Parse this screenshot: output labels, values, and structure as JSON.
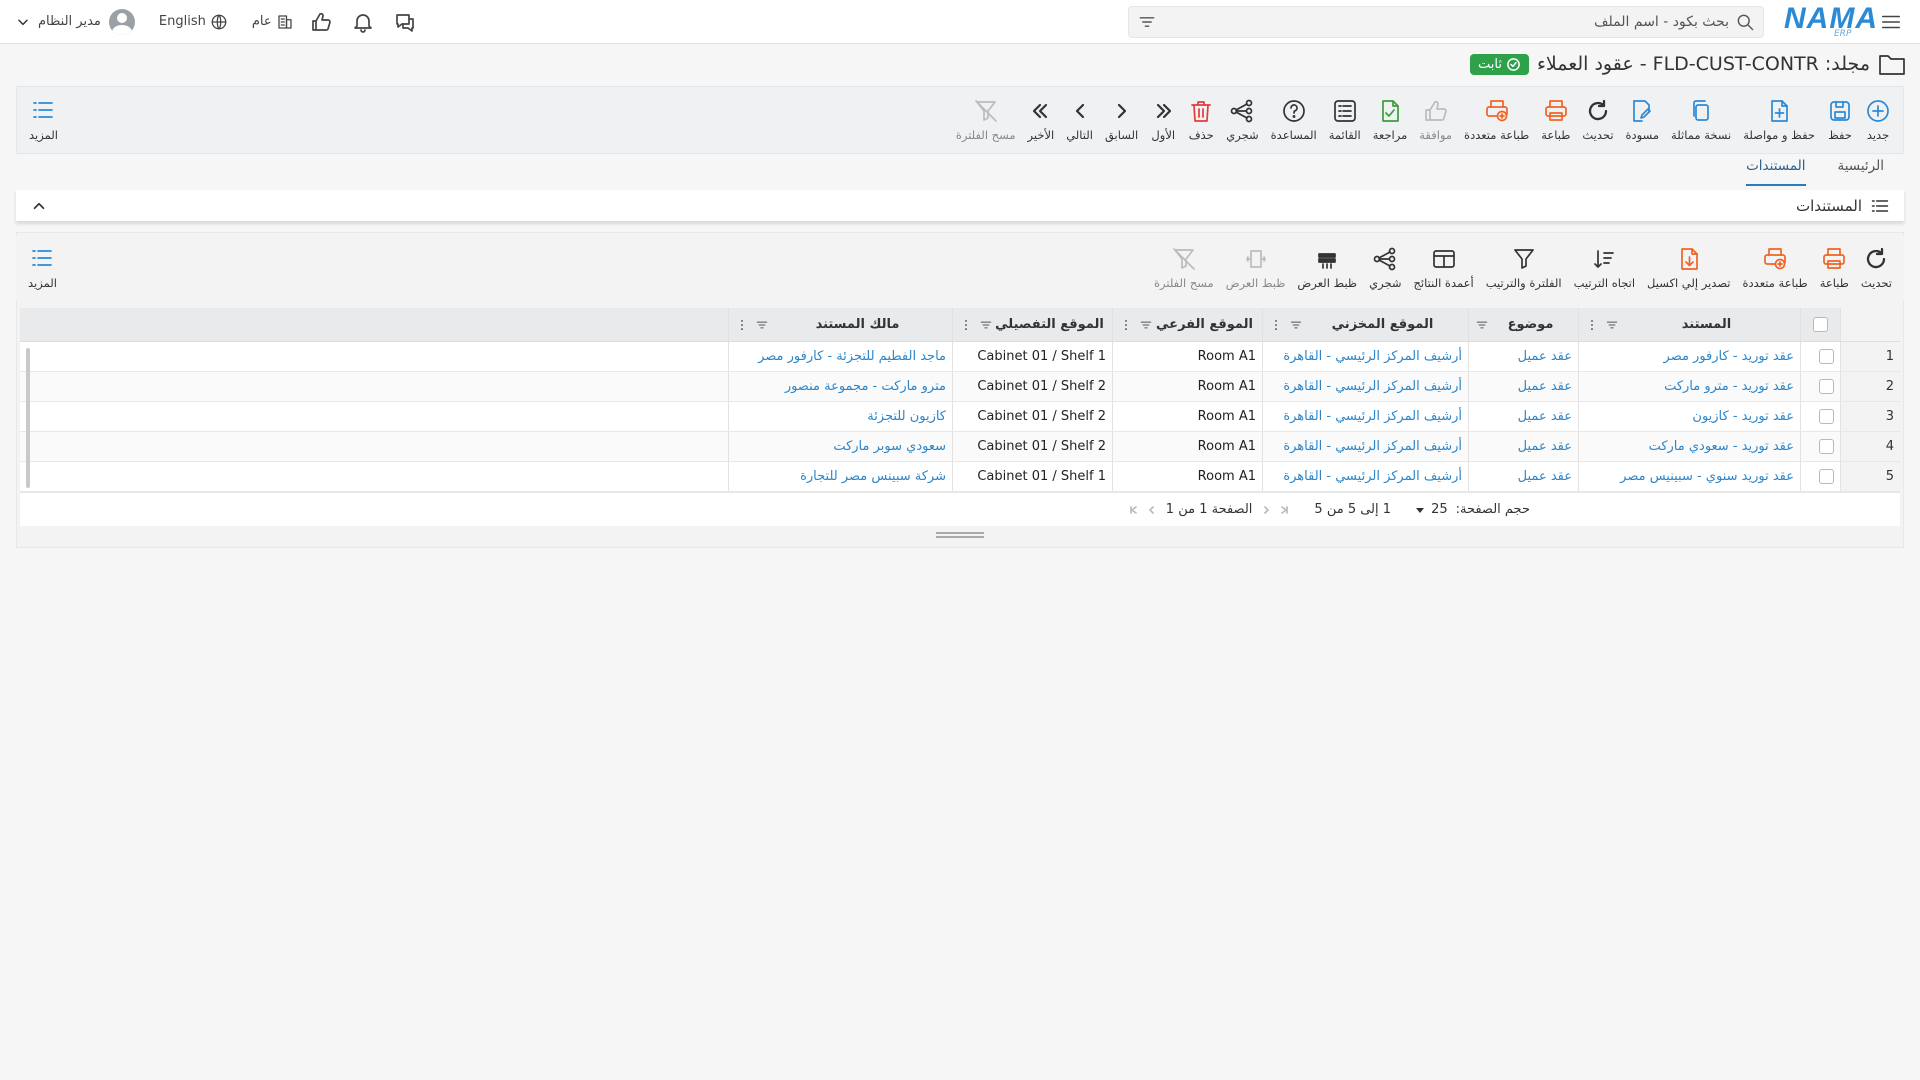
{
  "app": {
    "logo_text": "NAMA",
    "logo_sub": "ERP",
    "search_placeholder": "بحث بكود - اسم الملف",
    "language": "English",
    "scope": "عام",
    "user_name": "مدير النظام"
  },
  "title": {
    "text": "مجلد: FLD-CUST-CONTR - عقود العملاء",
    "status": "ثابت"
  },
  "main_toolbar": {
    "buttons": [
      {
        "label": "جديد",
        "icon": "plus-circle-icon"
      },
      {
        "label": "حفظ",
        "icon": "save-icon"
      },
      {
        "label": "حفظ و مواصلة",
        "icon": "save-continue-icon"
      },
      {
        "label": "نسخة مماثلة",
        "icon": "copy-icon"
      },
      {
        "label": "مسودة",
        "icon": "draft-icon"
      },
      {
        "label": "تحديث",
        "icon": "refresh-icon"
      },
      {
        "label": "طباعة",
        "icon": "print-icon"
      },
      {
        "label": "طباعة متعددة",
        "icon": "multi-print-icon"
      },
      {
        "label": "موافقة",
        "icon": "thumbs-up-icon"
      },
      {
        "label": "مراجعة",
        "icon": "review-icon"
      },
      {
        "label": "القائمة",
        "icon": "list-icon"
      },
      {
        "label": "المساعدة",
        "icon": "help-icon"
      },
      {
        "label": "شجري",
        "icon": "tree-icon"
      },
      {
        "label": "حذف",
        "icon": "trash-icon"
      },
      {
        "label": "الأول",
        "icon": "first-icon"
      },
      {
        "label": "السابق",
        "icon": "prev-icon"
      },
      {
        "label": "التالي",
        "icon": "next-icon"
      },
      {
        "label": "الأخير",
        "icon": "last-icon"
      },
      {
        "label": "مسح الفلترة",
        "icon": "clear-filter-icon"
      }
    ],
    "more": "المزيد"
  },
  "tabs": [
    {
      "label": "الرئيسية",
      "active": false
    },
    {
      "label": "المستندات",
      "active": true
    }
  ],
  "section": {
    "title": "المستندات"
  },
  "grid_toolbar": {
    "buttons": [
      {
        "label": "تحديث",
        "icon": "refresh-icon"
      },
      {
        "label": "طباعة",
        "icon": "print-icon"
      },
      {
        "label": "طباعة متعددة",
        "icon": "multi-print-icon"
      },
      {
        "label": "تصدير إلي اكسيل",
        "icon": "excel-export-icon"
      },
      {
        "label": "اتجاه الترتيب",
        "icon": "sort-direction-icon"
      },
      {
        "label": "الفلترة والترتيب",
        "icon": "filter-icon"
      },
      {
        "label": "أعمدة النتائج",
        "icon": "columns-icon"
      },
      {
        "label": "شجري",
        "icon": "tree-icon"
      },
      {
        "label": "ظبط العرض",
        "icon": "fit-width-icon"
      },
      {
        "label": "ظبط العرض",
        "icon": "fit-columns-icon"
      },
      {
        "label": "مسح الفلترة",
        "icon": "clear-filter-icon"
      }
    ],
    "more": "المزيد"
  },
  "grid": {
    "columns": [
      "المستند",
      "موضوع",
      "الموقع المخزني",
      "الموقع الفرعي",
      "الموقع التفصيلي",
      "مالك المستند"
    ],
    "rows": [
      {
        "n": "1",
        "doc": "عقد توريد - كارفور مصر",
        "subject": "عقد عميل",
        "location": "أرشيف المركز الرئيسي - القاهرة",
        "sub": "Room A1",
        "detail": "Cabinet 01 / Shelf 1",
        "owner": "ماجد الفطيم للتجزئة - كارفور مصر"
      },
      {
        "n": "2",
        "doc": "عقد توريد - مترو ماركت",
        "subject": "عقد عميل",
        "location": "أرشيف المركز الرئيسي - القاهرة",
        "sub": "Room A1",
        "detail": "Cabinet 01 / Shelf 2",
        "owner": "مترو ماركت - مجموعة منصور"
      },
      {
        "n": "3",
        "doc": "عقد توريد - كازيون",
        "subject": "عقد عميل",
        "location": "أرشيف المركز الرئيسي - القاهرة",
        "sub": "Room A1",
        "detail": "Cabinet 01 / Shelf 2",
        "owner": "كازيون للتجزئة"
      },
      {
        "n": "4",
        "doc": "عقد توريد - سعودي ماركت",
        "subject": "عقد عميل",
        "location": "أرشيف المركز الرئيسي - القاهرة",
        "sub": "Room A1",
        "detail": "Cabinet 01 / Shelf 2",
        "owner": "سعودي سوبر ماركت"
      },
      {
        "n": "5",
        "doc": "عقد توريد سنوي - سبينيس مصر",
        "subject": "عقد عميل",
        "location": "أرشيف المركز الرئيسي - القاهرة",
        "sub": "Room A1",
        "detail": "Cabinet 01 / Shelf 1",
        "owner": "شركة سبينس مصر للتجارة"
      }
    ]
  },
  "pager": {
    "page_size_label": "حجم الصفحة:",
    "page_size": "25",
    "range": "1 إلى 5 من 5",
    "page_info": "الصفحة 1 من 1"
  }
}
